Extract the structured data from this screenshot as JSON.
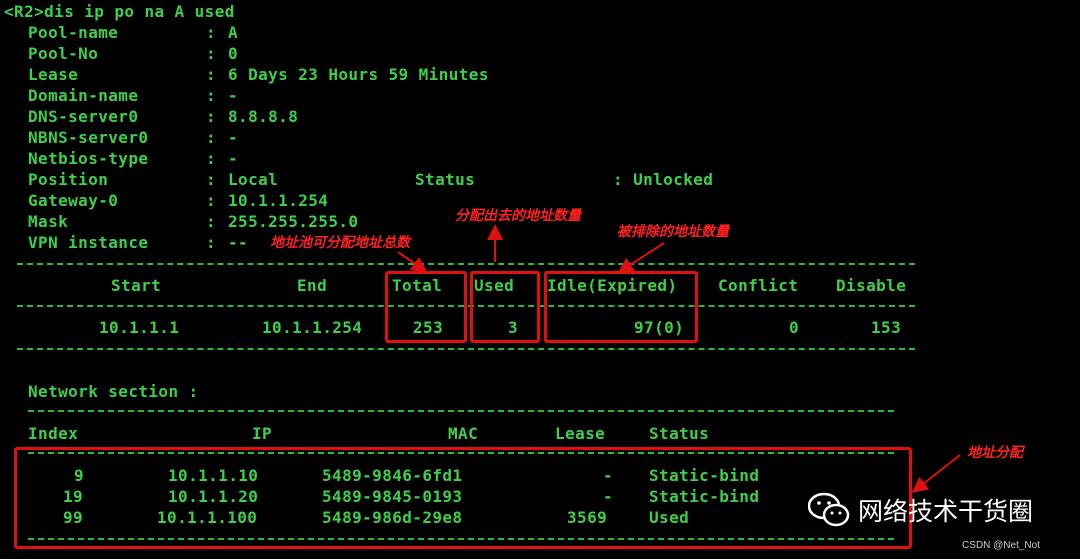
{
  "command": "<R2>dis ip po na A used",
  "pool_info": [
    {
      "key": "Pool-name",
      "value": "A"
    },
    {
      "key": "Pool-No",
      "value": "0"
    },
    {
      "key": "Lease",
      "value": "6 Days 23 Hours 59 Minutes"
    },
    {
      "key": "Domain-name",
      "value": "-"
    },
    {
      "key": "DNS-server0",
      "value": "8.8.8.8"
    },
    {
      "key": "NBNS-server0",
      "value": "-"
    },
    {
      "key": "Netbios-type",
      "value": "-"
    },
    {
      "key": "Position",
      "value": "Local"
    },
    {
      "key": "Gateway-0",
      "value": "10.1.1.254"
    },
    {
      "key": "Mask",
      "value": "255.255.255.0"
    },
    {
      "key": "VPN instance",
      "value": "--"
    }
  ],
  "status": {
    "label": "Status",
    "value": ": Unlocked"
  },
  "summary": {
    "headers": [
      "Start",
      "End",
      "Total",
      "Used",
      "Idle(Expired)",
      "Conflict",
      "Disable"
    ],
    "row": [
      "10.1.1.1",
      "10.1.1.254",
      "253",
      "3",
      "97(0)",
      "0",
      "153"
    ]
  },
  "network": {
    "title": "Network section :",
    "headers": [
      "Index",
      "IP",
      "MAC",
      "Lease",
      "Status"
    ],
    "rows": [
      [
        "9",
        "10.1.1.10",
        "5489-9846-6fd1",
        "-",
        "Static-bind"
      ],
      [
        "19",
        "10.1.1.20",
        "5489-9845-0193",
        "-",
        "Static-bind"
      ],
      [
        "99",
        "10.1.1.100",
        "5489-986d-29e8",
        "3569",
        "Used"
      ]
    ]
  },
  "annotations": {
    "total": "地址池可分配地址总数",
    "used": "分配出去的地址数量",
    "idle": "被排除的地址数量",
    "network": "地址分配"
  },
  "brand": {
    "name": "网络技术干货圈",
    "icon": "wechat-icon"
  },
  "credit": "CSDN @Net_Not",
  "colors": {
    "text": "#3fd04a",
    "annotation": "#e01010",
    "background": "#000000"
  }
}
